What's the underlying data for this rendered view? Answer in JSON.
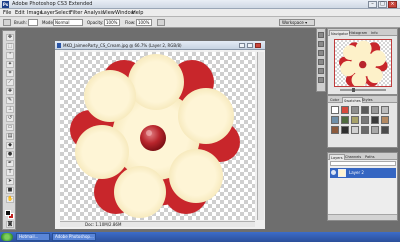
{
  "app": {
    "title": "Adobe Photoshop CS3 Extended",
    "logo_text": "Ps"
  },
  "menu": {
    "items": [
      "File",
      "Edit",
      "Image",
      "Layer",
      "Select",
      "Filter",
      "Analysis",
      "View",
      "Window",
      "Help"
    ]
  },
  "options": {
    "brush_label": "Brush:",
    "mode_label": "Mode:",
    "mode_value": "Normal",
    "opacity_label": "Opacity:",
    "opacity_value": "100%",
    "flow_label": "Flow:",
    "flow_value": "100%",
    "workspace_label": "Workspace ▾"
  },
  "document": {
    "title": "MKD_JaimeeParty_CS_Cream.jpg @ 66.7% (Layer 2, RGB/8)",
    "status": "Doc: 1.10M/2.86M",
    "flower": {
      "petal_color": "#fdf1c9",
      "under_color": "#c8262b",
      "button_color": "#b8252c"
    }
  },
  "panels": {
    "navigator_tabs": [
      "Navigator",
      "Histogram",
      "Info"
    ],
    "swatches_tabs": [
      "Color",
      "Swatches",
      "Styles"
    ],
    "layers_tabs": [
      "Layers",
      "Channels",
      "Paths"
    ],
    "layer_name": "Layer 2"
  },
  "taskbar": {
    "start_label": "",
    "tasks": [
      "Hotmail...",
      "Adobe Photoshop..."
    ]
  }
}
